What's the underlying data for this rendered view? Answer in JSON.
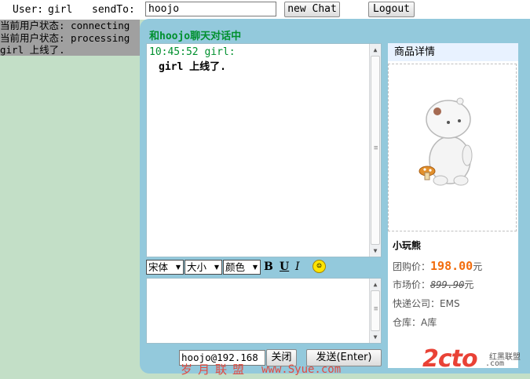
{
  "topbar": {
    "user_label": "User:",
    "user_name": "girl",
    "sendto_label": "sendTo:",
    "sendto_value": "hoojo",
    "new_chat_label": "new Chat",
    "logout_label": "Logout"
  },
  "status_log": [
    "当前用户状态: connecting",
    "当前用户状态: processing",
    "girl 上线了."
  ],
  "chat": {
    "title": "和hoojo聊天对话中",
    "messages": [
      {
        "header": "10:45:52 girl:",
        "body": "girl 上线了."
      }
    ],
    "toolbar": {
      "font_select": "宋体",
      "size_select": "大小",
      "color_select": "颜色",
      "bold": "B",
      "underline": "U",
      "italic": "I",
      "emoji_icon": "smiley-icon"
    },
    "address_value": "hoojo@192.168",
    "close_label": "关闭",
    "send_label": "发送(Enter)"
  },
  "product": {
    "panel_title": "商品详情",
    "name": "小玩熊",
    "group_price_label": "团购价：",
    "group_price": "198.00",
    "group_price_unit": "元",
    "market_price_label": "市场价：",
    "market_price": "899.90",
    "market_price_unit": "元",
    "courier_label": "快递公司：",
    "courier": "EMS",
    "warehouse_label": "仓库：",
    "warehouse": "A库"
  },
  "watermarks": {
    "cn": "岁月联盟",
    "url": "www.Syue.com",
    "logo": "2cto",
    "logo_sub": "红黑联盟",
    "logo_url": ".com"
  },
  "colors": {
    "window_bg": "#93c9dc",
    "page_bg": "#c3dfc7",
    "status_bg": "#a0a0a0",
    "title_green": "#00902e",
    "price_orange": "#f26d0e"
  }
}
